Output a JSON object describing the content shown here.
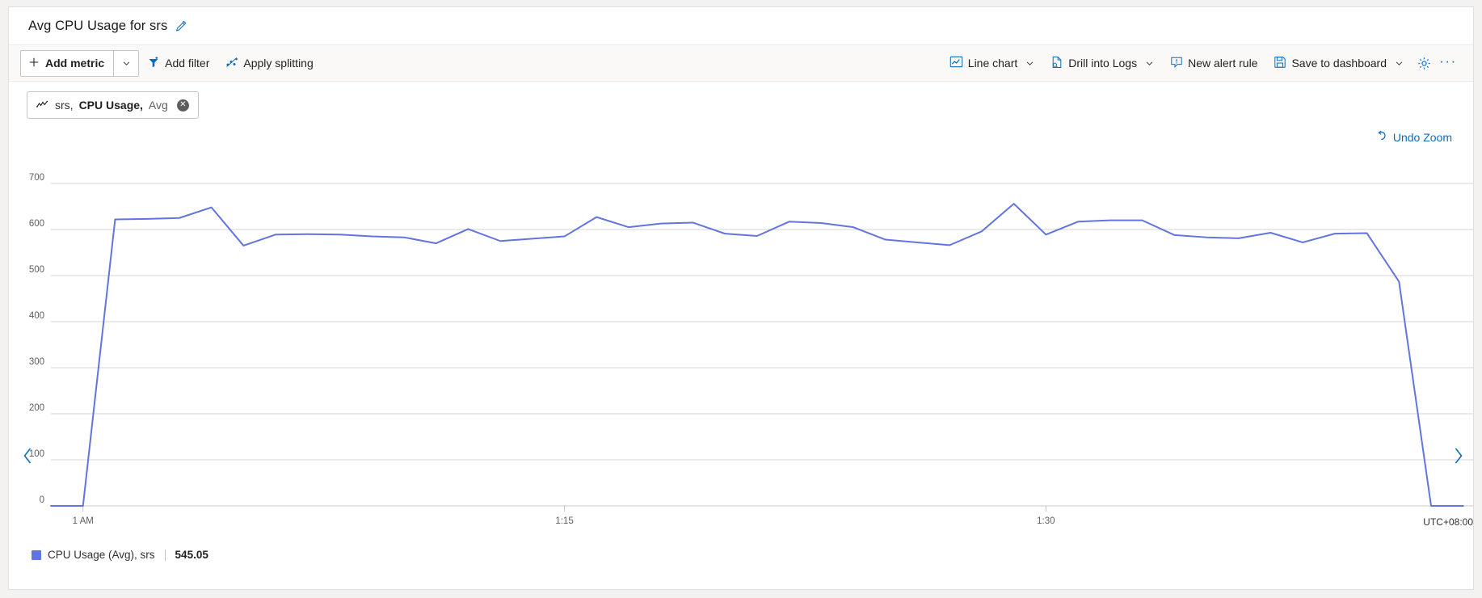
{
  "window": {
    "background": "#f3f2f1",
    "card_background": "#ffffff"
  },
  "header": {
    "title": "Avg CPU Usage for srs",
    "edit_icon": "pencil-icon"
  },
  "toolbar": {
    "add_metric_label": "Add metric",
    "add_metric_icon": "plus-icon",
    "add_metric_caret": "chevron-down-icon",
    "add_filter_label": "Add filter",
    "add_filter_icon": "filter-icon",
    "apply_splitting_label": "Apply splitting",
    "apply_splitting_icon": "splitting-icon",
    "line_chart_label": "Line chart",
    "line_chart_icon": "line-chart-icon",
    "drill_into_logs_label": "Drill into Logs",
    "drill_into_logs_icon": "logs-icon",
    "new_alert_rule_label": "New alert rule",
    "new_alert_rule_icon": "alert-icon",
    "save_to_dashboard_label": "Save to dashboard",
    "save_to_dashboard_icon": "save-icon",
    "settings_icon": "gear-icon",
    "more_label": "···",
    "accent_color": "#0f6cbd"
  },
  "metric_chip": {
    "icon": "metric-line-icon",
    "resource": "srs,",
    "metric": "CPU Usage,",
    "aggregation": "Avg",
    "close_label": "✕",
    "close_icon": "remove-metric-icon"
  },
  "chart_controls": {
    "undo_zoom_label": "Undo Zoom",
    "undo_zoom_icon": "undo-icon",
    "prev_icon": "chevron-left-icon",
    "next_icon": "chevron-right-icon"
  },
  "legend": {
    "swatch_color": "#6274e0",
    "label": "CPU Usage (Avg), srs",
    "value": "545.05"
  },
  "chart_data": {
    "type": "line",
    "title": "Avg CPU Usage for srs",
    "xlabel": "",
    "ylabel": "",
    "ylim": [
      0,
      700
    ],
    "yticks": [
      0,
      100,
      200,
      300,
      400,
      500,
      600,
      700
    ],
    "ytick_labels": [
      "0",
      "100",
      "200",
      "300",
      "400",
      "500",
      "600",
      "700"
    ],
    "grid": true,
    "legend_position": "bottom-left",
    "timezone": "UTC+08:00",
    "xticks": [
      1,
      16,
      31
    ],
    "xtick_labels": [
      "1 AM",
      "1:15",
      "1:30"
    ],
    "x_index_max": 43,
    "series": [
      {
        "name": "CPU Usage (Avg), srs",
        "color": "#6274e0",
        "values": [
          0,
          0,
          622,
          623,
          625,
          648,
          565,
          589,
          590,
          589,
          585,
          583,
          570,
          601,
          575,
          580,
          585,
          627,
          605,
          613,
          615,
          591,
          586,
          617,
          614,
          605,
          578,
          572,
          566,
          596,
          656,
          589,
          617,
          620,
          620,
          588,
          583,
          581,
          593,
          572,
          591,
          592,
          487,
          0,
          0
        ]
      }
    ]
  }
}
